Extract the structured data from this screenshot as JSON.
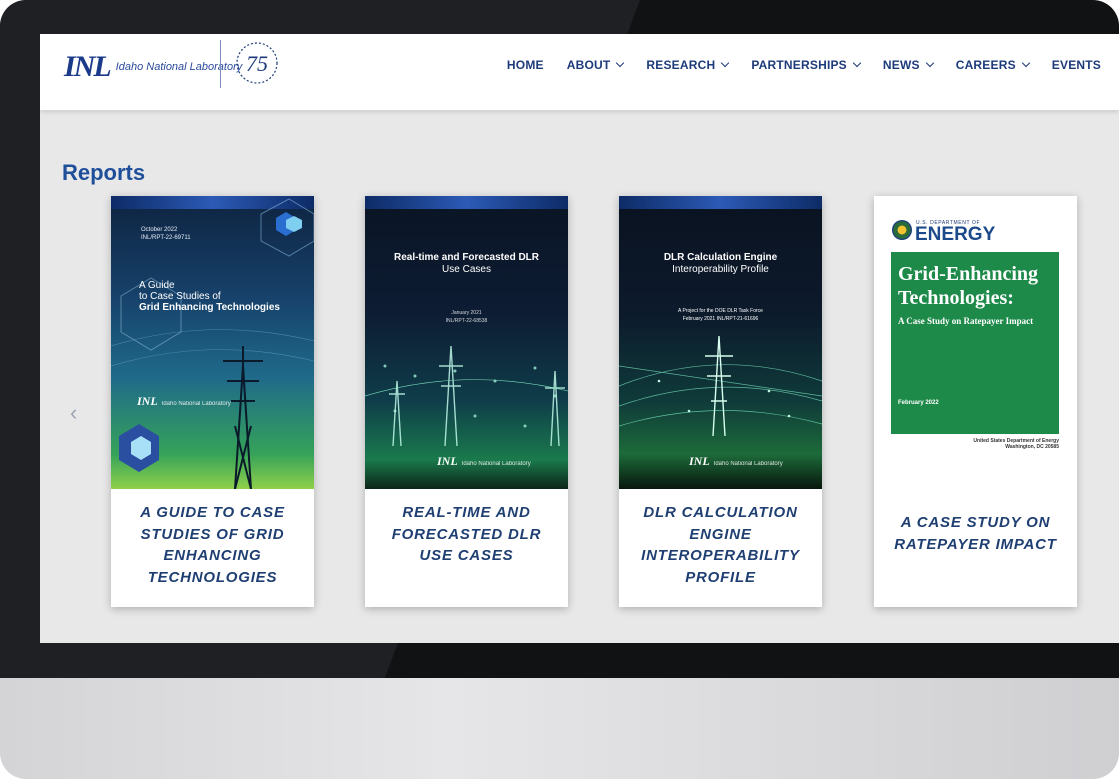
{
  "logo": {
    "mark": "INL",
    "name": "Idaho National Laboratory",
    "anniversary": "75"
  },
  "nav": [
    {
      "label": "HOME",
      "dropdown": false
    },
    {
      "label": "ABOUT",
      "dropdown": true
    },
    {
      "label": "RESEARCH",
      "dropdown": true
    },
    {
      "label": "PARTNERSHIPS",
      "dropdown": true
    },
    {
      "label": "NEWS",
      "dropdown": true
    },
    {
      "label": "CAREERS",
      "dropdown": true
    },
    {
      "label": "EVENTS",
      "dropdown": false
    }
  ],
  "section_title": "Reports",
  "carousel": {
    "prev_icon": "‹"
  },
  "reports": [
    {
      "title": "A GUIDE TO CASE STUDIES OF GRID ENHANCING TECHNOLOGIES",
      "cover": {
        "meta": [
          "October 2022",
          "INL/RPT-22-69711"
        ],
        "heading": [
          "A Guide",
          "to Case Studies of"
        ],
        "heading_bold": "Grid Enhancing Technologies",
        "logo_mark": "INL",
        "logo_tag": "Idaho National Laboratory"
      }
    },
    {
      "title": "REAL-TIME AND FORECASTED DLR USE CASES",
      "cover": {
        "heading_bold": "Real-time and Forecasted DLR",
        "heading": "Use Cases",
        "meta": [
          "January 2021",
          "INL/RPT-22-68538"
        ],
        "logo_mark": "INL",
        "logo_tag": "Idaho National Laboratory"
      }
    },
    {
      "title": "DLR CALCULATION ENGINE INTEROPERABILITY PROFILE",
      "cover": {
        "heading_bold": "DLR Calculation Engine",
        "heading": "Interoperability Profile",
        "meta": [
          "A Project for the DOE DLR Task Force",
          "February 2021  INL/RPT-21-61696"
        ],
        "logo_mark": "INL",
        "logo_tag": "Idaho National Laboratory"
      }
    },
    {
      "title": "A CASE STUDY ON RATEPAYER IMPACT",
      "cover": {
        "agency_small": "U.S. DEPARTMENT OF",
        "agency": "ENERGY",
        "heading_bold": "Grid-Enhancing Technologies:",
        "heading": "A Case Study on Ratepayer Impact",
        "date": "February 2022",
        "footer": [
          "United States Department of Energy",
          "Washington, DC 20585"
        ]
      }
    }
  ],
  "colors": {
    "brand_blue": "#1d3a7a",
    "report_title": "#1f3f72",
    "doe_green": "#1e8a4a"
  }
}
